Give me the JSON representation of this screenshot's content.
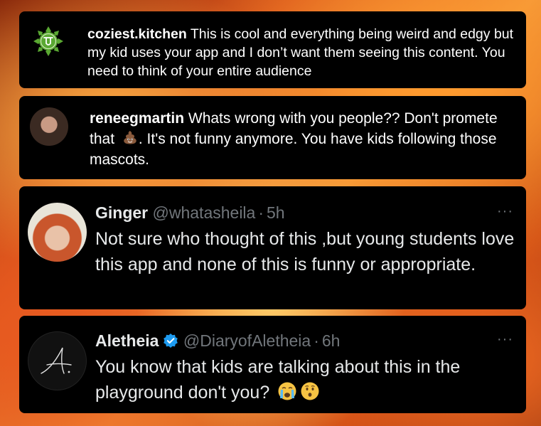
{
  "comments": [
    {
      "platform": "instagram",
      "username": "coziest.kitchen",
      "text": " This is cool and everything being weird and edgy but my kid uses your app and I don’t want them seeing this content. You need to think of your entire audience"
    },
    {
      "platform": "instagram",
      "username": "reneegmartin",
      "text_before_emoji": " Whats wrong with you people?? Don't promete that ",
      "emoji": "poop-emoji",
      "text_after_emoji": ". It's not funny anymore. You have kids following those mascots."
    }
  ],
  "tweets": [
    {
      "name": "Ginger",
      "handle": "@whatasheila",
      "separator": "·",
      "time": "5h",
      "more": "···",
      "text": "Not sure who thought of this ,but young students love this app and none of this is funny or appropriate."
    },
    {
      "name": "Aletheia",
      "verified": true,
      "handle": "@DiaryofAletheia",
      "separator": "·",
      "time": "6h",
      "more": "···",
      "text": "You know that kids are talking about this in the playground don't you?",
      "emojis": [
        "crying-face-emoji",
        "hushed-face-emoji"
      ]
    }
  ],
  "colors": {
    "card_bg": "#000000",
    "text_primary": "#e7e9ea",
    "text_secondary": "#71767b",
    "verified_blue": "#1d9bf0",
    "lotus_green": "#5aa832"
  }
}
